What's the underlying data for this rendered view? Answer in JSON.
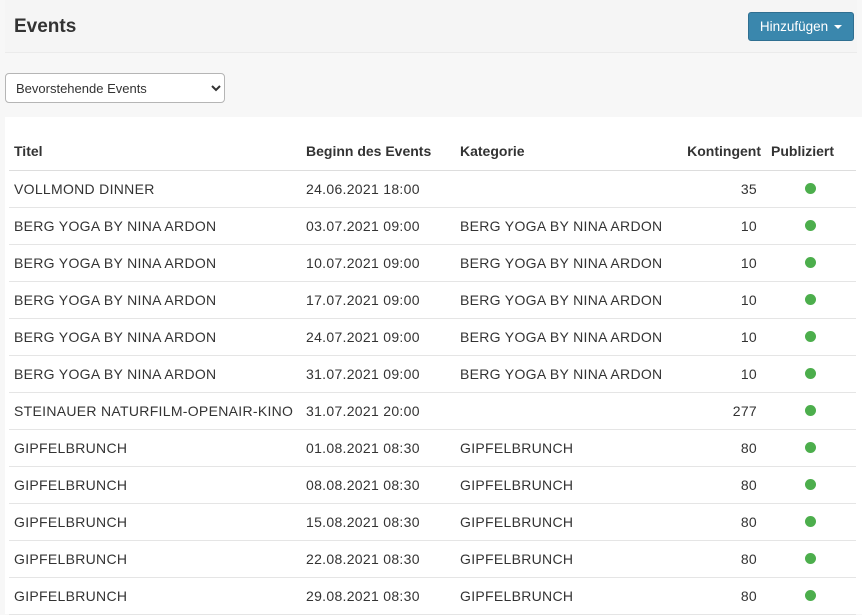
{
  "header": {
    "title": "Events",
    "add_button": "Hinzufügen"
  },
  "filter": {
    "selected": "Bevorstehende Events"
  },
  "table": {
    "columns": {
      "title": "Titel",
      "begin": "Beginn des Events",
      "category": "Kategorie",
      "kontingent": "Kontingent",
      "published": "Publiziert"
    },
    "status_color": "#4cae4c",
    "rows": [
      {
        "title": "VOLLMOND DINNER",
        "begin": "24.06.2021 18:00",
        "category": "",
        "kontingent": "35",
        "published": true
      },
      {
        "title": "BERG YOGA BY NINA ARDON",
        "begin": "03.07.2021 09:00",
        "category": "BERG YOGA BY NINA ARDON",
        "kontingent": "10",
        "published": true
      },
      {
        "title": "BERG YOGA BY NINA ARDON",
        "begin": "10.07.2021 09:00",
        "category": "BERG YOGA BY NINA ARDON",
        "kontingent": "10",
        "published": true
      },
      {
        "title": "BERG YOGA BY NINA ARDON",
        "begin": "17.07.2021 09:00",
        "category": "BERG YOGA BY NINA ARDON",
        "kontingent": "10",
        "published": true
      },
      {
        "title": "BERG YOGA BY NINA ARDON",
        "begin": "24.07.2021 09:00",
        "category": "BERG YOGA BY NINA ARDON",
        "kontingent": "10",
        "published": true
      },
      {
        "title": "BERG YOGA BY NINA ARDON",
        "begin": "31.07.2021 09:00",
        "category": "BERG YOGA BY NINA ARDON",
        "kontingent": "10",
        "published": true
      },
      {
        "title": "STEINAUER NATURFILM-OPENAIR-KINO",
        "begin": "31.07.2021 20:00",
        "category": "",
        "kontingent": "277",
        "published": true
      },
      {
        "title": "GIPFELBRUNCH",
        "begin": "01.08.2021 08:30",
        "category": "GIPFELBRUNCH",
        "kontingent": "80",
        "published": true
      },
      {
        "title": "GIPFELBRUNCH",
        "begin": "08.08.2021 08:30",
        "category": "GIPFELBRUNCH",
        "kontingent": "80",
        "published": true
      },
      {
        "title": "GIPFELBRUNCH",
        "begin": "15.08.2021 08:30",
        "category": "GIPFELBRUNCH",
        "kontingent": "80",
        "published": true
      },
      {
        "title": "GIPFELBRUNCH",
        "begin": "22.08.2021 08:30",
        "category": "GIPFELBRUNCH",
        "kontingent": "80",
        "published": true
      },
      {
        "title": "GIPFELBRUNCH",
        "begin": "29.08.2021 08:30",
        "category": "GIPFELBRUNCH",
        "kontingent": "80",
        "published": true
      }
    ]
  }
}
